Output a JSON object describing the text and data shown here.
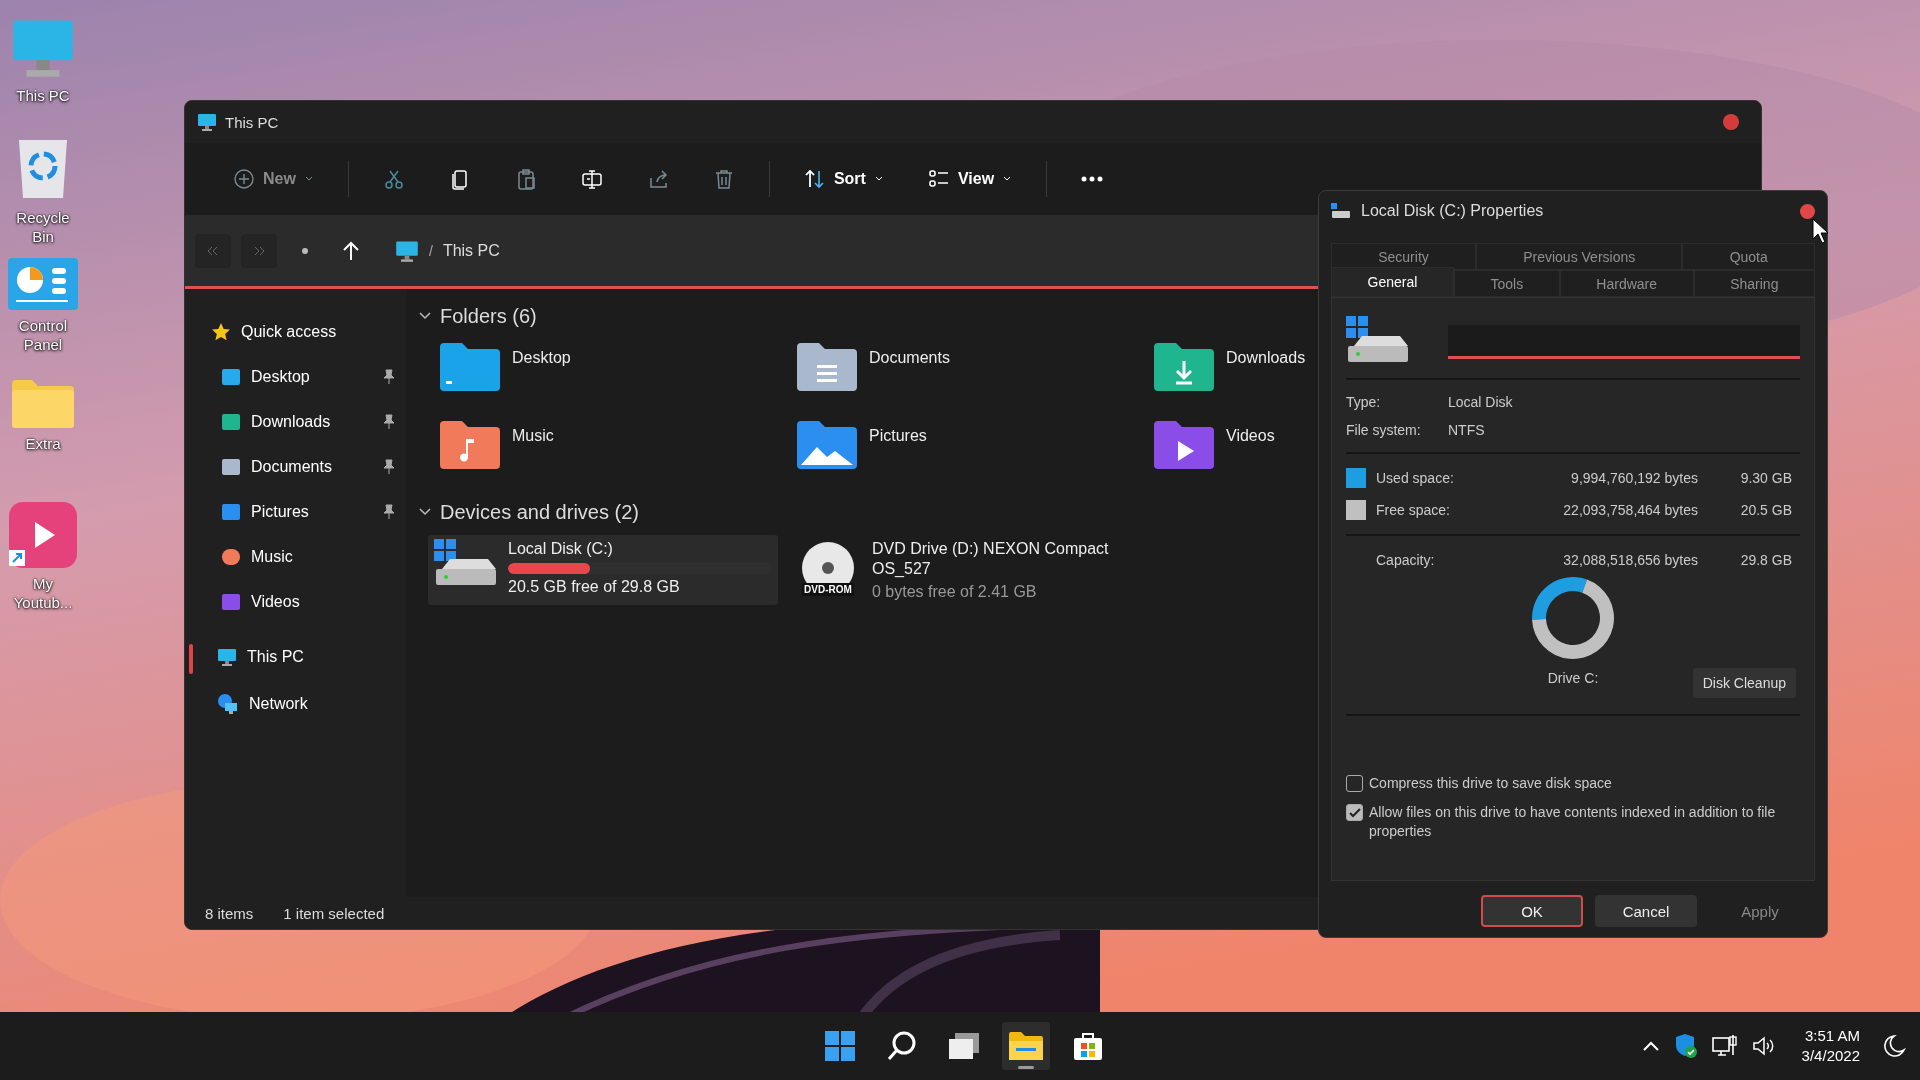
{
  "desktop_icons": [
    {
      "label": "This PC"
    },
    {
      "label": "Recycle Bin"
    },
    {
      "label": "Control Panel"
    },
    {
      "label": "Extra"
    },
    {
      "label": "My Youtub..."
    }
  ],
  "explorer": {
    "title": "This PC",
    "toolbar": [
      {
        "kind": "labeled",
        "label": "New",
        "disabled": true
      },
      {
        "kind": "separator"
      },
      {
        "kind": "icon",
        "disabled": true
      },
      {
        "kind": "icon",
        "disabled": false
      },
      {
        "kind": "icon",
        "disabled": true
      },
      {
        "kind": "icon",
        "disabled": false
      },
      {
        "kind": "icon",
        "disabled": true
      },
      {
        "kind": "icon",
        "disabled": true
      },
      {
        "kind": "separator"
      },
      {
        "kind": "labeled",
        "label": "Sort",
        "disabled": false
      },
      {
        "kind": "labeled",
        "label": "View",
        "disabled": false
      },
      {
        "kind": "separator"
      },
      {
        "kind": "more",
        "disabled": false
      }
    ],
    "navigation": [
      {
        "kind": "back",
        "disabled": true
      },
      {
        "kind": "forward",
        "disabled": true
      },
      {
        "kind": "recent",
        "disabled": false
      },
      {
        "kind": "up",
        "disabled": false
      }
    ],
    "breadcrumb": {
      "separator": "/",
      "location": "This PC"
    },
    "sidebar": {
      "items": [
        {
          "label": "Quick access",
          "selected": false,
          "children": [
            {
              "label": "Desktop",
              "pinned": true,
              "selected": false
            },
            {
              "label": "Downloads",
              "pinned": true,
              "selected": false
            },
            {
              "label": "Documents",
              "pinned": true,
              "selected": false
            },
            {
              "label": "Pictures",
              "pinned": true,
              "selected": false
            },
            {
              "label": "Music",
              "pinned": false,
              "selected": false
            },
            {
              "label": "Videos",
              "pinned": false,
              "selected": false
            }
          ]
        },
        {
          "label": "This PC",
          "selected": true
        },
        {
          "label": "Network",
          "selected": false
        }
      ]
    },
    "folders": {
      "heading": "Folders (6)",
      "expanded": true,
      "items": [
        {
          "name": "Desktop"
        },
        {
          "name": "Documents"
        },
        {
          "name": "Downloads"
        },
        {
          "name": "Music"
        },
        {
          "name": "Pictures"
        },
        {
          "name": "Videos"
        }
      ]
    },
    "drives": {
      "heading": "Devices and drives (2)",
      "expanded": true,
      "items": [
        {
          "kind": "disk",
          "name": "Local Disk (C:)",
          "level": 0.31,
          "detail": "20.5 GB free of 29.8 GB",
          "selected": true
        },
        {
          "kind": "dvd",
          "name": "DVD Drive (D:) NEXON Compact OS_527",
          "icon_label": "DVD-ROM",
          "detail": "0 bytes free of 2.41 GB",
          "selected": false
        }
      ]
    },
    "status_bar": {
      "item_count": "8 items",
      "selection": "1 item selected"
    }
  },
  "properties": {
    "title": "Local Disk (C:) Properties",
    "tab_rows": [
      {
        "tabs": [
          {
            "label": "Security",
            "selected": false
          },
          {
            "label": "Previous Versions",
            "selected": false
          },
          {
            "label": "Quota",
            "selected": false
          }
        ]
      },
      {
        "tabs": [
          {
            "label": "General",
            "selected": true
          },
          {
            "label": "Tools",
            "selected": false
          },
          {
            "label": "Hardware",
            "selected": false
          },
          {
            "label": "Sharing",
            "selected": false
          }
        ]
      }
    ],
    "info": [
      {
        "label": "Type:",
        "value": "Local Disk"
      },
      {
        "label": "File system:",
        "value": "NTFS"
      }
    ],
    "space": [
      {
        "label": "Used space:",
        "bytes": "9,994,760,192 bytes",
        "size": "9.30 GB",
        "color": "#1e9de0"
      },
      {
        "label": "Free space:",
        "bytes": "22,093,758,464 bytes",
        "size": "20.5 GB",
        "color": "#c0c0c0"
      }
    ],
    "capacity": {
      "label": "Capacity:",
      "bytes": "32,088,518,656 bytes",
      "size": "29.8 GB"
    },
    "usage_chart": {
      "chart_data": {
        "type": "donut",
        "series": [
          {
            "values": [
              31.2,
              68.8
            ]
          }
        ]
      }
    },
    "drive_label": "Drive C:",
    "cleanup_button": "Disk Cleanup",
    "options": [
      {
        "label": "Compress this drive to save disk space",
        "checked": false
      },
      {
        "label": "Allow files on this drive to have contents indexed in addition to file properties",
        "checked": true
      }
    ],
    "buttons": [
      {
        "label": "OK",
        "focused": true,
        "disabled": false
      },
      {
        "label": "Cancel",
        "focused": false,
        "disabled": false
      },
      {
        "label": "Apply",
        "focused": false,
        "disabled": true
      }
    ]
  },
  "taskbar": {
    "apps": [
      {
        "active": false
      },
      {
        "active": false
      },
      {
        "active": false
      },
      {
        "active": true
      },
      {
        "active": false
      }
    ],
    "tray": {
      "time": "3:51 AM",
      "date": "3/4/2022"
    }
  }
}
